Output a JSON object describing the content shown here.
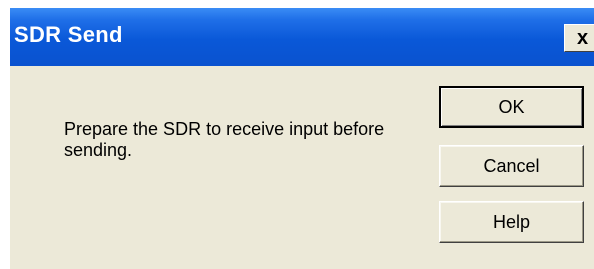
{
  "window": {
    "title": "SDR Send",
    "close_glyph": "x",
    "close_icon": "close-icon"
  },
  "message": {
    "text": "Prepare the SDR to receive input before sending."
  },
  "buttons": {
    "ok_label": "OK",
    "cancel_label": "Cancel",
    "help_label": "Help"
  },
  "colors": {
    "titlebar": "#0a58d8",
    "dialog_background": "#ece9d8",
    "title_text": "#ffffff"
  }
}
